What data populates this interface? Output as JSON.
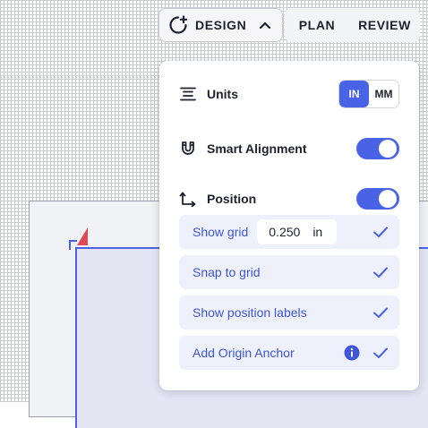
{
  "topbar": {
    "design_label": "DESIGN",
    "plan_label": "PLAN",
    "review_label": "REVIEW"
  },
  "panel": {
    "units": {
      "label": "Units",
      "options": [
        "IN",
        "MM"
      ],
      "selected": "IN"
    },
    "smart_alignment": {
      "label": "Smart Alignment",
      "enabled": true
    },
    "position": {
      "label": "Position",
      "enabled": true
    },
    "show_grid": {
      "label": "Show grid",
      "value": "0.250",
      "unit": "in",
      "checked": true
    },
    "snap_to_grid": {
      "label": "Snap to grid",
      "checked": true
    },
    "show_position_labels": {
      "label": "Show position labels",
      "checked": true
    },
    "add_origin_anchor": {
      "label": "Add Origin Anchor",
      "checked": true
    }
  },
  "colors": {
    "accent": "#4a63e6",
    "sub_row_bg": "#eef0fb",
    "origin_flag": "#e04a57"
  },
  "icons": {
    "design": "add-design-icon",
    "chevron": "chevron-up-icon",
    "units": "align-center-lines-icon",
    "smart_alignment": "magnet-icon",
    "position": "position-arrows-icon",
    "check": "check-icon",
    "info": "info-icon"
  }
}
